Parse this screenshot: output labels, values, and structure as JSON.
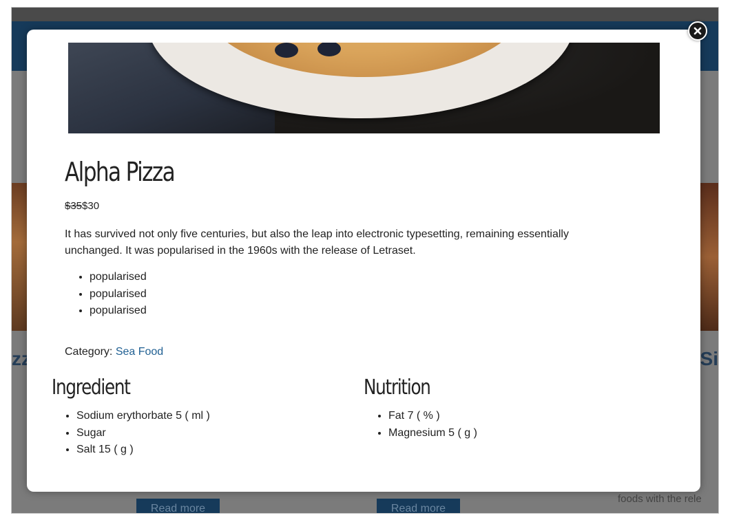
{
  "background": {
    "left_heading_fragment": "zz",
    "right_heading_fragment": "Si",
    "read_more_labels": [
      "Read more",
      "Read more"
    ],
    "footer_fragment": "foods with the rele"
  },
  "modal": {
    "title": "Alpha Pizza",
    "price_old": "$35",
    "price_new": "$30",
    "description": "It has survived not only five centuries, but also the leap into electronic typesetting, remaining essentially unchanged. It was popularised in the 1960s with the release of Letraset.",
    "features": [
      "popularised",
      "popularised",
      "popularised"
    ],
    "category_label": "Category: ",
    "category_link": "Sea Food",
    "ingredient_title": "Ingredient",
    "ingredients": [
      "Sodium erythorbate 5 ( ml )",
      "Sugar",
      "Salt 15 ( g )"
    ],
    "nutrition_title": "Nutrition",
    "nutrition": [
      "Fat 7 ( % )",
      "Magnesium 5 ( g )"
    ]
  },
  "icons": {
    "close": "close-icon"
  },
  "colors": {
    "link": "#1f5f92",
    "overlay_bar": "#163a5a"
  }
}
